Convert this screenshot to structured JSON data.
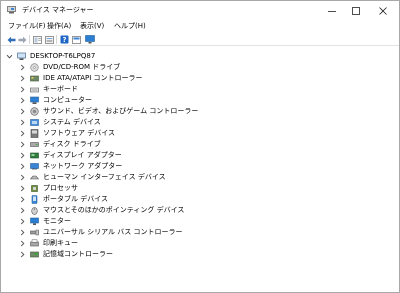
{
  "window": {
    "title": "デバイス マネージャー",
    "controls": [
      "minimize",
      "maximize",
      "close"
    ]
  },
  "menu": [
    "ファイル(F)",
    "操作(A)",
    "表示(V)",
    "ヘルプ(H)"
  ],
  "toolbar": [
    "back-icon",
    "forward-icon",
    "properties-view-icon",
    "help-icon",
    "list-view-icon",
    "monitor-icon"
  ],
  "tree": {
    "root": {
      "label": "DESKTOP-T6LPQ87",
      "icon": "computer-icon",
      "expanded": true
    },
    "items": [
      {
        "label": "DVD/CD-ROM ドライブ",
        "icon": "dvd-drive-icon"
      },
      {
        "label": "IDE ATA/ATAPI コントローラー",
        "icon": "ide-controller-icon"
      },
      {
        "label": "キーボード",
        "icon": "keyboard-icon"
      },
      {
        "label": "コンピューター",
        "icon": "computer-icon"
      },
      {
        "label": "サウンド、ビデオ、およびゲーム コントローラー",
        "icon": "speaker-icon"
      },
      {
        "label": "システム デバイス",
        "icon": "system-device-icon"
      },
      {
        "label": "ソフトウェア デバイス",
        "icon": "software-device-icon"
      },
      {
        "label": "ディスク ドライブ",
        "icon": "disk-drive-icon"
      },
      {
        "label": "ディスプレイ アダプター",
        "icon": "display-adapter-icon"
      },
      {
        "label": "ネットワーク アダプター",
        "icon": "network-adapter-icon"
      },
      {
        "label": "ヒューマン インターフェイス デバイス",
        "icon": "hid-icon"
      },
      {
        "label": "プロセッサ",
        "icon": "processor-icon"
      },
      {
        "label": "ポータブル デバイス",
        "icon": "portable-device-icon"
      },
      {
        "label": "マウスとそのほかのポインティング デバイス",
        "icon": "mouse-icon"
      },
      {
        "label": "モニター",
        "icon": "monitor-icon"
      },
      {
        "label": "ユニバーサル シリアル バス コントローラー",
        "icon": "usb-controller-icon"
      },
      {
        "label": "印刷キュー",
        "icon": "printer-icon"
      },
      {
        "label": "記憶域コントローラー",
        "icon": "storage-controller-icon"
      }
    ]
  }
}
